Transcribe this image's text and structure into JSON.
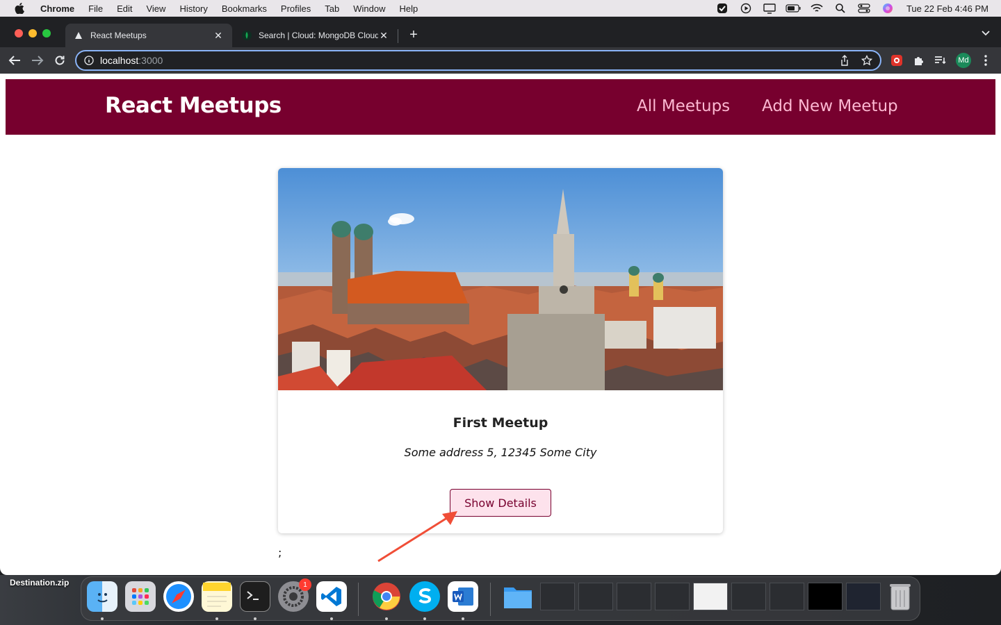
{
  "menubar": {
    "app_name": "Chrome",
    "items": [
      "File",
      "Edit",
      "View",
      "History",
      "Bookmarks",
      "Profiles",
      "Tab",
      "Window",
      "Help"
    ],
    "clock": "Tue 22 Feb  4:46 PM"
  },
  "browser": {
    "tabs": [
      {
        "title": "React Meetups",
        "active": true
      },
      {
        "title": "Search | Cloud: MongoDB Cloud",
        "active": false
      }
    ],
    "url_host": "localhost",
    "url_port": ":3000",
    "profile_initials": "Md"
  },
  "site": {
    "logo": "React Meetups",
    "nav": {
      "all_meetups": "All Meetups",
      "add_new_meetup": "Add New Meetup"
    },
    "meetup": {
      "title": "First Meetup",
      "address": "Some address 5, 12345 Some City",
      "button_label": "Show Details",
      "image_subject": "Munich city skyline with Frauenkirche and town hall tower"
    },
    "stray_text": ";",
    "colors": {
      "header_bg": "#77002e",
      "nav_link": "#fcb8d2",
      "button_bg": "#fde2ec",
      "annotation_arrow": "#f04e37"
    }
  },
  "desktop": {
    "file_label": "Destination.zip"
  },
  "dock": {
    "apps": [
      "Finder",
      "Launchpad",
      "Safari",
      "Notes",
      "Terminal",
      "System Preferences",
      "Visual Studio Code",
      "Google Chrome",
      "Skype",
      "Microsoft Word",
      "Downloads folder"
    ],
    "system_preferences_badge": "1"
  }
}
